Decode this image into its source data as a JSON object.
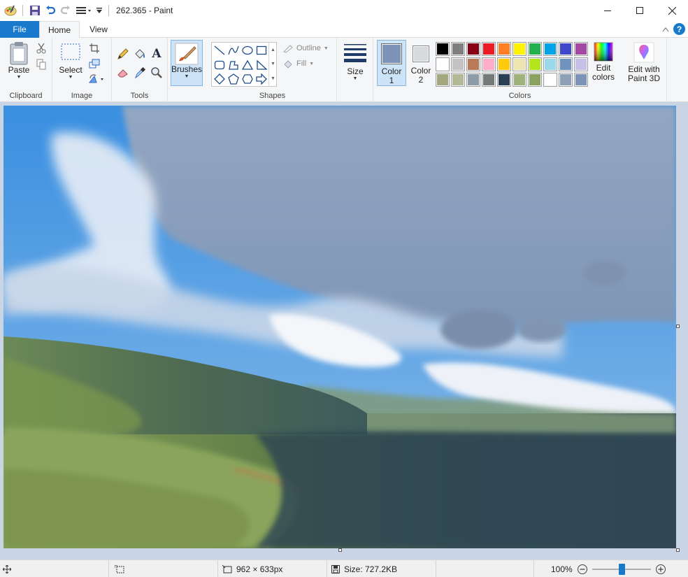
{
  "window": {
    "title": "262.365 - Paint"
  },
  "tabs": {
    "file": "File",
    "home": "Home",
    "view": "View"
  },
  "ribbon": {
    "clipboard": {
      "paste": "Paste",
      "group": "Clipboard"
    },
    "image": {
      "select": "Select",
      "group": "Image"
    },
    "tools": {
      "group": "Tools"
    },
    "brushes": {
      "label": "Brushes"
    },
    "shapes": {
      "outline": "Outline",
      "fill": "Fill",
      "group": "Shapes"
    },
    "size": {
      "label": "Size"
    },
    "colors": {
      "color1": "Color 1",
      "color1_line2": "1",
      "color1_line1": "Color",
      "color2_line1": "Color",
      "color2_line2": "2",
      "group": "Colors",
      "edit_line1": "Edit",
      "edit_line2": "colors",
      "color1_value": "#7b94b8",
      "color2_value": "#d6dadd",
      "palette_row1": [
        "#000000",
        "#7f7f7f",
        "#880015",
        "#ed1c24",
        "#ff7f27",
        "#fff200",
        "#22b14c",
        "#00a2e8",
        "#3f48cc",
        "#a349a4"
      ],
      "palette_row2": [
        "#ffffff",
        "#c3c3c3",
        "#b97a57",
        "#ffaec9",
        "#ffc90e",
        "#efe4b0",
        "#b5e61d",
        "#99d9ea",
        "#7092be",
        "#c8bfe7"
      ],
      "palette_row3": [
        "#a3a87f",
        "#b3b895",
        "#8e9ba9",
        "#727b78",
        "#2a3f52",
        "#9fb27b",
        "#8aa25f",
        "#ffffff",
        "#8ea0b8",
        "#7b94b8"
      ]
    },
    "paint3d": {
      "line1": "Edit with",
      "line2": "Paint 3D"
    }
  },
  "status": {
    "dimensions": "962 × 633px",
    "size": "Size: 727.2KB",
    "zoom": "100%",
    "zoom_slider_fraction": 0.5
  }
}
